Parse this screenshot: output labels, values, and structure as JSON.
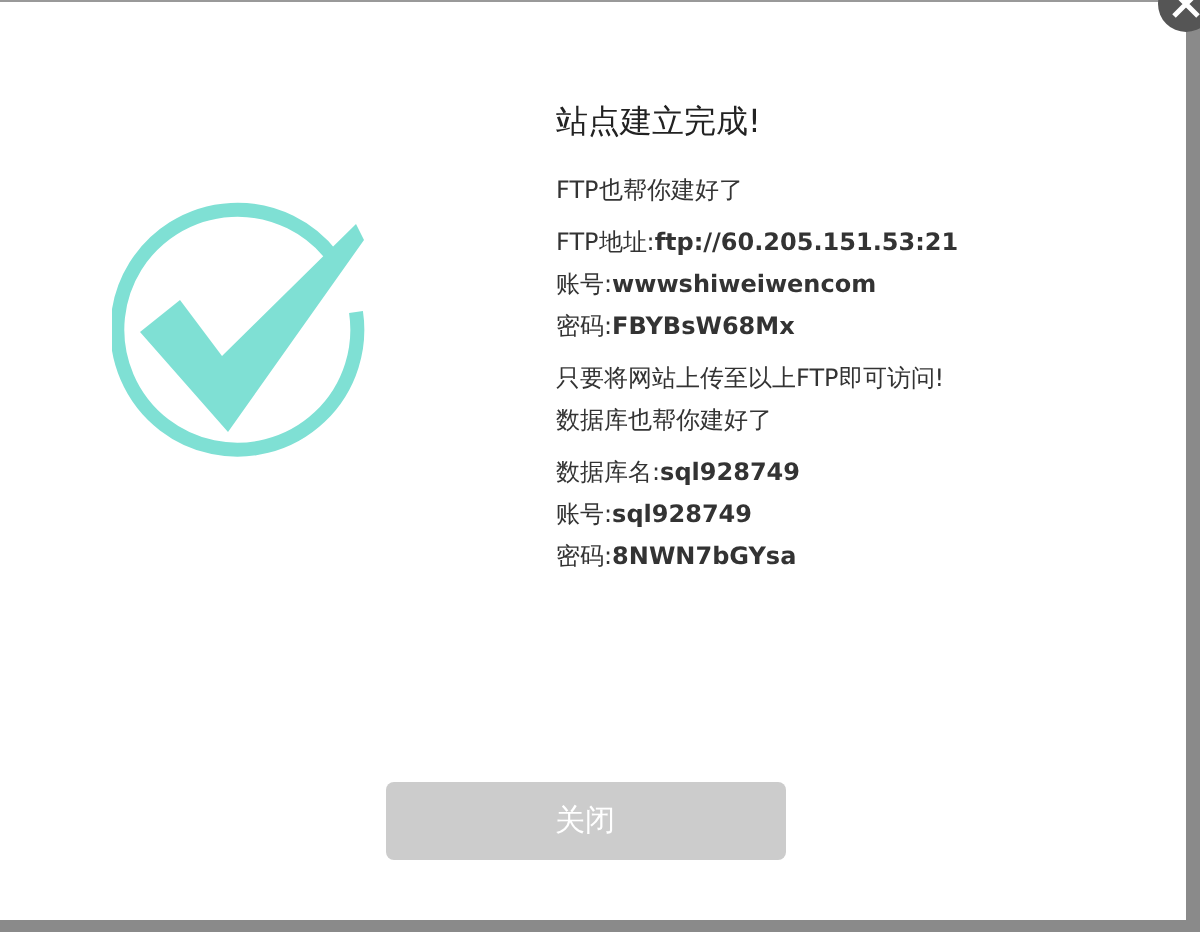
{
  "title": "站点建立完成!",
  "sections": [
    {
      "lines": [
        {
          "text": "FTP也帮你建好了"
        }
      ]
    },
    {
      "lines": [
        {
          "label": "FTP地址:",
          "value": "ftp://60.205.151.53:21"
        },
        {
          "label": "账号:",
          "value": "wwwshiweiwencom"
        },
        {
          "label": "密码:",
          "value": "FBYBsW68Mx"
        }
      ]
    },
    {
      "lines": [
        {
          "text": "只要将网站上传至以上FTP即可访问!"
        },
        {
          "text": "数据库也帮你建好了"
        }
      ]
    },
    {
      "lines": [
        {
          "label": "数据库名:",
          "value": "sql928749"
        },
        {
          "label": "账号:",
          "value": "sql928749"
        },
        {
          "label": "密码:",
          "value": "8NWN7bGYsa"
        }
      ]
    }
  ],
  "close_button": {
    "label": "关闭",
    "disabled": true
  }
}
